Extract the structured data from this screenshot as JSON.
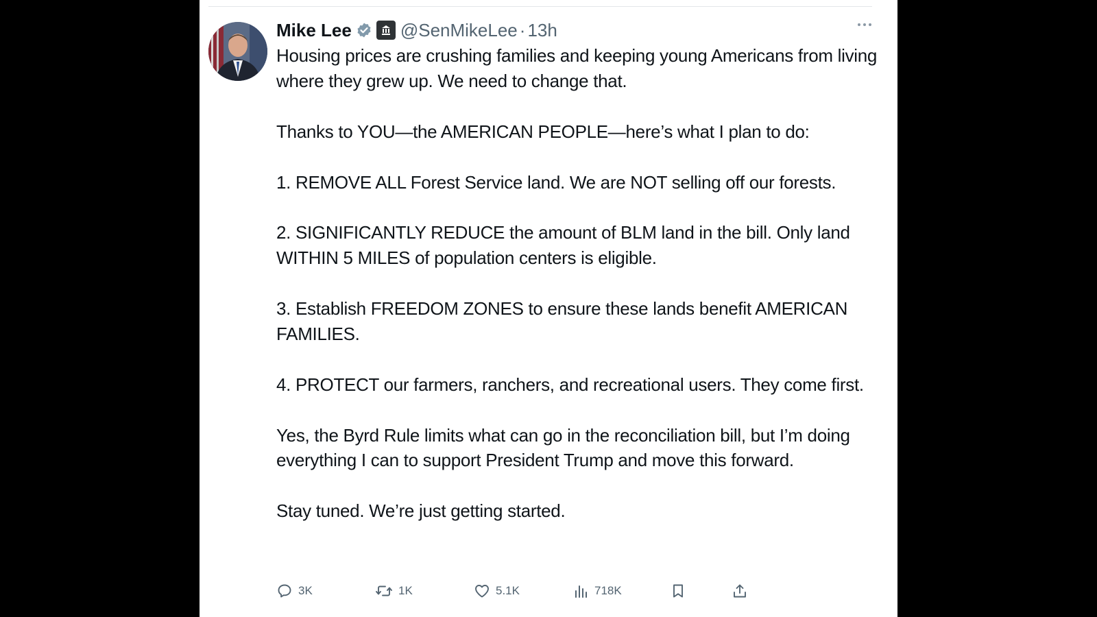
{
  "tweet": {
    "author_name": "Mike Lee",
    "handle": "@SenMikeLee",
    "separator": "·",
    "time": "13h",
    "paragraphs": [
      "Housing prices are crushing families and keeping young Americans from living where they grew up. We need to change that.",
      "Thanks to YOU—the AMERICAN PEOPLE—here’s what I plan to do:",
      "1. REMOVE ALL Forest Service land. We are NOT selling off our forests.",
      "2. SIGNIFICANTLY REDUCE the amount of BLM land in the bill. Only land WITHIN 5 MILES of population centers is eligible.",
      "3. Establish FREEDOM ZONES to ensure these lands benefit AMERICAN FAMILIES.",
      "4. PROTECT our farmers, ranchers, and recreational users. They come first.",
      "Yes, the Byrd Rule limits what can go in the reconciliation bill, but I’m doing everything I can to support President Trump and move this forward.",
      "Stay tuned. We’re just getting started."
    ],
    "actions": {
      "replies": "3K",
      "reposts": "1K",
      "likes": "5.1K",
      "views": "718K"
    }
  },
  "icons": {
    "verified": "verified-badge-icon",
    "government": "government-building-icon",
    "more": "more-options-icon",
    "reply": "reply-icon",
    "repost": "repost-icon",
    "like": "heart-icon",
    "views": "views-chart-icon",
    "bookmark": "bookmark-icon",
    "share": "share-icon"
  },
  "colors": {
    "text_primary": "#0f1419",
    "text_secondary": "#536471",
    "verified_badge": "#829aab",
    "background_outer": "#000000"
  }
}
